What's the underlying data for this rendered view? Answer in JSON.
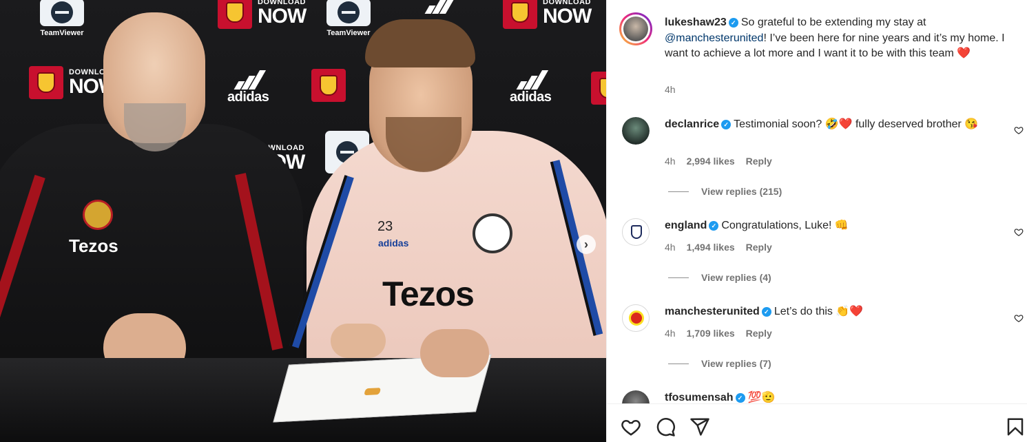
{
  "photo": {
    "sponsor_download_small": "DOWNLOAD",
    "sponsor_download_big": "NOW",
    "sponsor_teamviewer": "TeamViewer",
    "sponsor_adidas": "adidas",
    "shirt_sponsor": "Tezos",
    "shirt_number": "23",
    "next_icon": "chevron-right-icon"
  },
  "post": {
    "username": "lukeshaw23",
    "caption_before_mention": "So grateful to be extending my stay at ",
    "mention": "@manchesterunited",
    "caption_after_mention": "! I’ve been here for nine years and it’s my home. I want to achieve a lot more and I want it to be with this team ",
    "caption_emoji": "❤️",
    "time": "4h"
  },
  "comments": [
    {
      "username": "declanrice",
      "text": "Testimonial soon? 🤣❤️ fully deserved brother 😘",
      "time": "4h",
      "likes": "2,994 likes",
      "reply_label": "Reply",
      "view_replies": "View replies (215)"
    },
    {
      "username": "england",
      "text": "Congratulations, Luke! 👊",
      "time": "4h",
      "likes": "1,494 likes",
      "reply_label": "Reply",
      "view_replies": "View replies (4)"
    },
    {
      "username": "manchesterunited",
      "text": "Let’s do this 👏❤️",
      "time": "4h",
      "likes": "1,709 likes",
      "reply_label": "Reply",
      "view_replies": "View replies (7)"
    },
    {
      "username": "tfosumensah",
      "text": "💯🫡",
      "time": "",
      "likes": "",
      "reply_label": "",
      "view_replies": ""
    }
  ],
  "actions": {
    "like_icon": "heart-icon",
    "comment_icon": "comment-icon",
    "share_icon": "share-icon",
    "save_icon": "bookmark-icon"
  },
  "colors": {
    "mention": "#00376b",
    "verified": "#1d9bf0",
    "muted": "#737373"
  }
}
